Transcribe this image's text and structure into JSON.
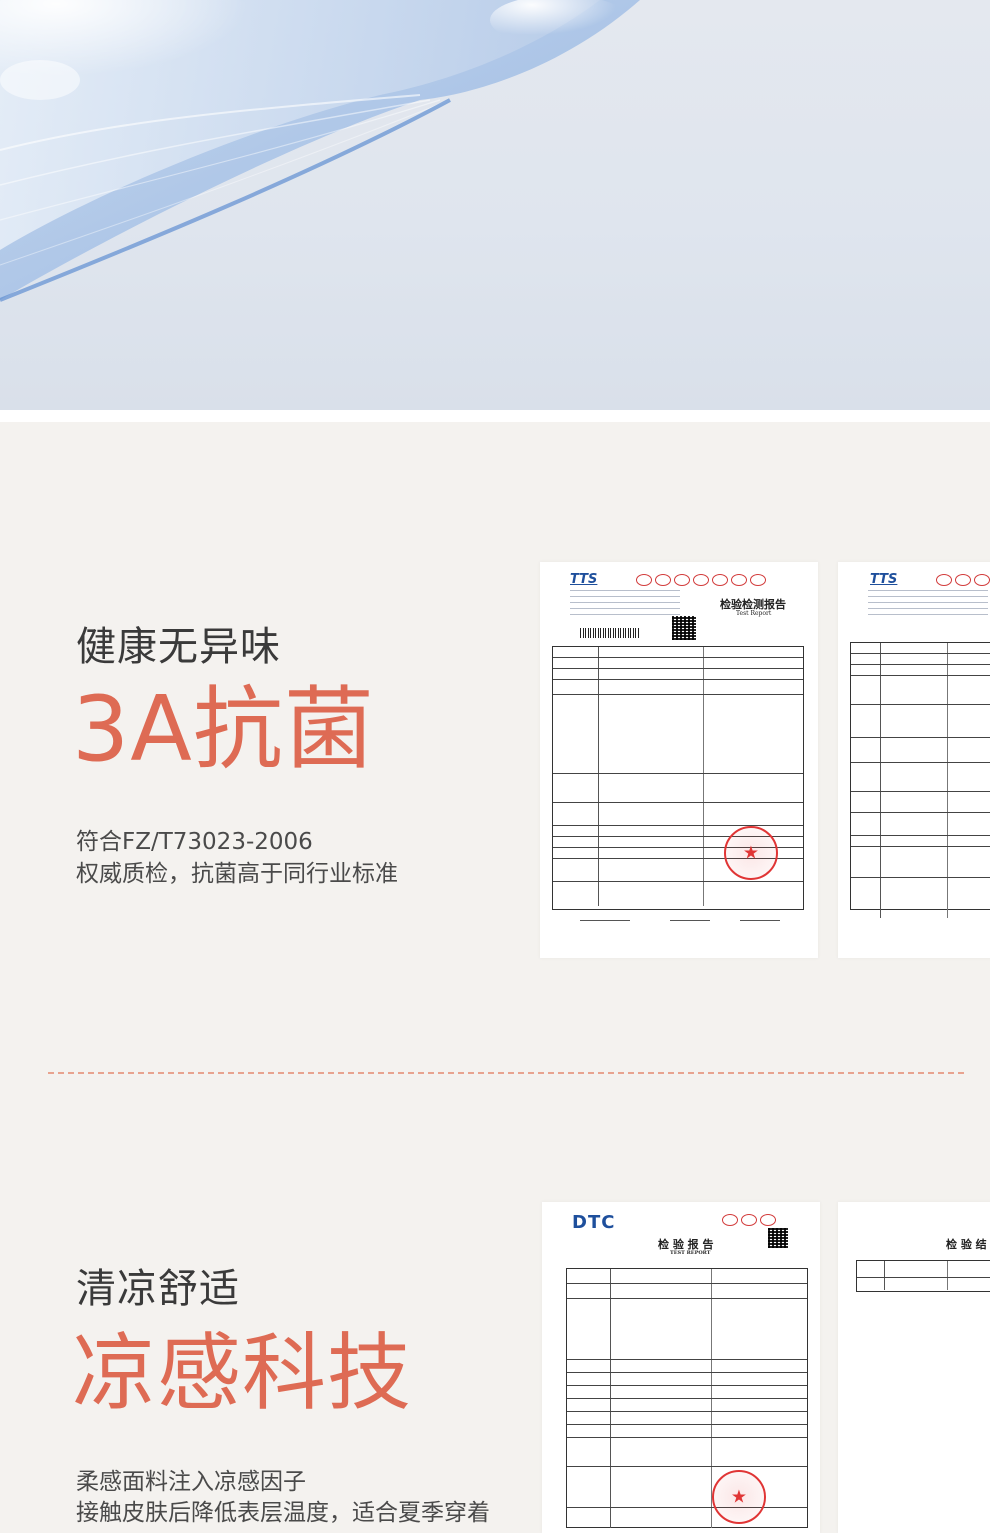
{
  "section_antibacterial": {
    "kicker": "健康无异味",
    "headline": "3A抗菌",
    "desc_line1": "符合FZ/T73023-2006",
    "desc_line2": "权威质检，抗菌高于同行业标准"
  },
  "section_cooling": {
    "kicker": "清凉舒适",
    "headline": "凉感科技",
    "desc_line1": "柔感面料注入凉感因子",
    "desc_line2": "接触皮肤后降低表层温度，适合夏季穿着"
  },
  "report_antibacterial_1": {
    "logo": "TTS",
    "title_cn": "检验检测报告",
    "title_en": "Test Report"
  },
  "report_antibacterial_2": {
    "logo": "TTS"
  },
  "report_cooling_1": {
    "logo": "DTC",
    "title_cn": "检 验 报 告",
    "title_en": "TEST REPORT"
  },
  "report_cooling_2": {
    "title_cn": "检 验 结"
  },
  "colors": {
    "accent": "#de6b54",
    "stamp_red": "#e03535",
    "divider": "#e8a38f",
    "logo_blue": "#1e4f9c"
  }
}
